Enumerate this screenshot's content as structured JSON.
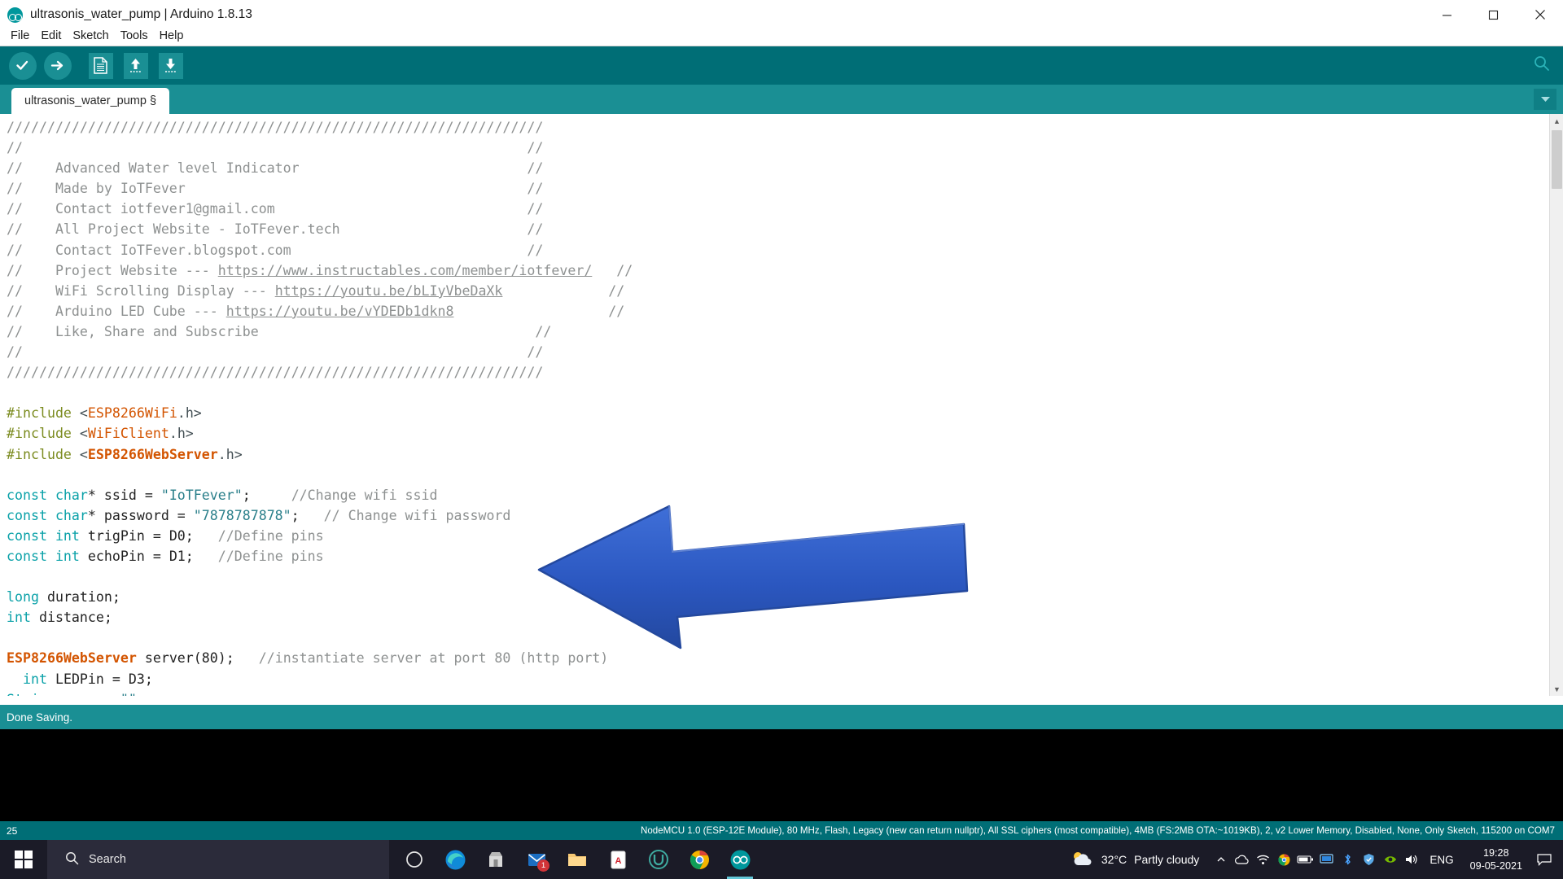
{
  "window": {
    "title": "ultrasonis_water_pump | Arduino 1.8.13",
    "logo_icon": "arduino-logo-icon",
    "minimize_icon": "minimize-icon",
    "maximize_icon": "maximize-icon",
    "close_icon": "close-icon"
  },
  "menu": {
    "items": [
      {
        "label": "File"
      },
      {
        "label": "Edit"
      },
      {
        "label": "Sketch"
      },
      {
        "label": "Tools"
      },
      {
        "label": "Help"
      }
    ]
  },
  "toolbar": {
    "verify_icon": "checkmark-verify-icon",
    "upload_icon": "arrow-right-upload-icon",
    "new_icon": "new-sketch-icon",
    "open_icon": "open-arrow-up-icon",
    "save_icon": "save-arrow-down-icon",
    "serial_monitor_icon": "serial-monitor-magnifier-icon"
  },
  "tabs": {
    "active_tab_label": "ultrasonis_water_pump §",
    "dropdown_icon": "chevron-down-icon"
  },
  "editor": {
    "lines": [
      {
        "tokens": [
          {
            "t": "//////////////////////////////////////////////////////////////////",
            "c": "cm"
          }
        ]
      },
      {
        "tokens": [
          {
            "t": "//                                                              //",
            "c": "cm"
          }
        ]
      },
      {
        "tokens": [
          {
            "t": "//    Advanced Water level Indicator                            //",
            "c": "cm"
          }
        ]
      },
      {
        "tokens": [
          {
            "t": "//    Made by IoTFever                                          //",
            "c": "cm"
          }
        ]
      },
      {
        "tokens": [
          {
            "t": "//    Contact iotfever1@gmail.com                               //",
            "c": "cm"
          }
        ]
      },
      {
        "tokens": [
          {
            "t": "//    All Project Website - IoTFever.tech                       //",
            "c": "cm"
          }
        ]
      },
      {
        "tokens": [
          {
            "t": "//    Contact IoTFever.blogspot.com                             //",
            "c": "cm"
          }
        ]
      },
      {
        "tokens": [
          {
            "t": "//    Project Website --- ",
            "c": "cm"
          },
          {
            "t": "https://www.instructables.com/member/iotfever/",
            "c": "cmul"
          },
          {
            "t": "   //",
            "c": "cm"
          }
        ]
      },
      {
        "tokens": [
          {
            "t": "//    WiFi Scrolling Display --- ",
            "c": "cm"
          },
          {
            "t": "https://youtu.be/bLIyVbeDaXk",
            "c": "cmul"
          },
          {
            "t": "             //",
            "c": "cm"
          }
        ]
      },
      {
        "tokens": [
          {
            "t": "//    Arduino LED Cube --- ",
            "c": "cm"
          },
          {
            "t": "https://youtu.be/vYDEDb1dkn8",
            "c": "cmul"
          },
          {
            "t": "                   //",
            "c": "cm"
          }
        ]
      },
      {
        "tokens": [
          {
            "t": "//    Like, Share and Subscribe                                  //",
            "c": "cm"
          }
        ]
      },
      {
        "tokens": [
          {
            "t": "//                                                              //",
            "c": "cm"
          }
        ]
      },
      {
        "tokens": [
          {
            "t": "//////////////////////////////////////////////////////////////////",
            "c": "cm"
          }
        ]
      },
      {
        "tokens": [
          {
            "t": "",
            "c": "pl"
          }
        ]
      },
      {
        "tokens": [
          {
            "t": "#include ",
            "c": "pre"
          },
          {
            "t": "<",
            "c": "op"
          },
          {
            "t": "ESP8266WiFi",
            "c": "lib"
          },
          {
            "t": ".h>",
            "c": "op"
          }
        ]
      },
      {
        "tokens": [
          {
            "t": "#include ",
            "c": "pre"
          },
          {
            "t": "<",
            "c": "op"
          },
          {
            "t": "WiFiClient",
            "c": "lib"
          },
          {
            "t": ".h>",
            "c": "op"
          }
        ]
      },
      {
        "tokens": [
          {
            "t": "#include ",
            "c": "pre"
          },
          {
            "t": "<",
            "c": "op"
          },
          {
            "t": "ESP8266WebServer",
            "c": "libb"
          },
          {
            "t": ".h>",
            "c": "op"
          }
        ]
      },
      {
        "tokens": [
          {
            "t": "",
            "c": "pl"
          }
        ]
      },
      {
        "tokens": [
          {
            "t": "const char",
            "c": "kw"
          },
          {
            "t": "* ssid = ",
            "c": "pl"
          },
          {
            "t": "\"IoTFever\"",
            "c": "str"
          },
          {
            "t": ";     ",
            "c": "pl"
          },
          {
            "t": "//Change wifi ssid",
            "c": "cm"
          }
        ]
      },
      {
        "tokens": [
          {
            "t": "const char",
            "c": "kw"
          },
          {
            "t": "* password = ",
            "c": "pl"
          },
          {
            "t": "\"7878787878\"",
            "c": "str"
          },
          {
            "t": ";   ",
            "c": "pl"
          },
          {
            "t": "// Change wifi password",
            "c": "cm"
          }
        ]
      },
      {
        "tokens": [
          {
            "t": "const int",
            "c": "kw"
          },
          {
            "t": " trigPin = D0;   ",
            "c": "pl"
          },
          {
            "t": "//Define pins",
            "c": "cm"
          }
        ]
      },
      {
        "tokens": [
          {
            "t": "const int",
            "c": "kw"
          },
          {
            "t": " echoPin = D1;   ",
            "c": "pl"
          },
          {
            "t": "//Define pins",
            "c": "cm"
          }
        ]
      },
      {
        "tokens": [
          {
            "t": "",
            "c": "pl"
          }
        ]
      },
      {
        "tokens": [
          {
            "t": "long",
            "c": "kw"
          },
          {
            "t": " duration;",
            "c": "pl"
          }
        ]
      },
      {
        "tokens": [
          {
            "t": "int",
            "c": "kw"
          },
          {
            "t": " distance;",
            "c": "pl"
          }
        ]
      },
      {
        "tokens": [
          {
            "t": "",
            "c": "pl"
          }
        ]
      },
      {
        "tokens": [
          {
            "t": "ESP8266WebServer",
            "c": "libb"
          },
          {
            "t": " server(80);   ",
            "c": "pl"
          },
          {
            "t": "//instantiate server at port 80 (http port)",
            "c": "cm"
          }
        ]
      },
      {
        "tokens": [
          {
            "t": "  ",
            "c": "pl"
          },
          {
            "t": "int",
            "c": "kw"
          },
          {
            "t": " LEDPin = D3;",
            "c": "pl"
          }
        ]
      },
      {
        "tokens": [
          {
            "t": "String",
            "c": "kw"
          },
          {
            "t": " page = ",
            "c": "pl"
          },
          {
            "t": "\"\"",
            "c": "str"
          },
          {
            "t": ";",
            "c": "pl"
          }
        ]
      }
    ],
    "scrollbar": {
      "up_icon": "scroll-up-arrow-icon",
      "down_icon": "scroll-down-arrow-icon"
    }
  },
  "annotation": {
    "arrow_icon": "blue-left-arrow-annotation",
    "color": "#2b5bc4"
  },
  "status": {
    "message": "Done Saving.",
    "line_number": "25",
    "board_info": "NodeMCU 1.0 (ESP-12E Module), 80 MHz, Flash, Legacy (new can return nullptr), All SSL ciphers (most compatible), 4MB (FS:2MB OTA:~1019KB), 2, v2 Lower Memory, Disabled, None, Only Sketch, 115200 on COM7"
  },
  "taskbar": {
    "start_icon": "windows-start-icon",
    "search": {
      "icon": "search-icon",
      "placeholder": "Search",
      "value": "Search"
    },
    "apps": [
      {
        "name": "task-view-icon",
        "badge": ""
      },
      {
        "name": "edge-browser-icon",
        "badge": ""
      },
      {
        "name": "microsoft-store-icon",
        "badge": ""
      },
      {
        "name": "mail-icon",
        "badge": "1"
      },
      {
        "name": "file-explorer-icon",
        "badge": ""
      },
      {
        "name": "adobe-acrobat-icon",
        "badge": ""
      },
      {
        "name": "rufus-icon",
        "badge": ""
      },
      {
        "name": "chrome-browser-icon",
        "badge": ""
      },
      {
        "name": "arduino-ide-icon",
        "badge": ""
      }
    ],
    "weather": {
      "icon": "partly-cloudy-icon",
      "temperature": "32°C",
      "condition": "Partly cloudy"
    },
    "tray_icons": [
      {
        "name": "chevron-up-show-hidden-icon"
      },
      {
        "name": "onedrive-icon"
      },
      {
        "name": "wifi-signal-icon"
      },
      {
        "name": "chrome-tray-icon"
      },
      {
        "name": "battery-icon"
      },
      {
        "name": "monitor-display-icon"
      },
      {
        "name": "bluetooth-icon"
      },
      {
        "name": "shield-security-icon"
      },
      {
        "name": "nvidia-tray-icon"
      },
      {
        "name": "volume-speaker-icon"
      }
    ],
    "language": "ENG",
    "clock": {
      "time": "19:28",
      "date": "09-05-2021"
    },
    "notification_icon": "notification-center-icon"
  }
}
